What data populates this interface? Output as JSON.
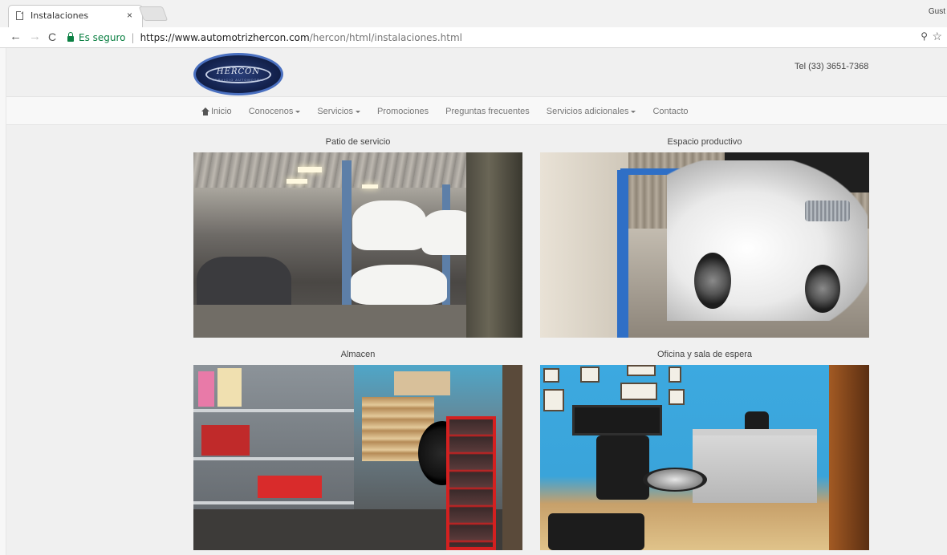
{
  "browser": {
    "tab_title": "Instalaciones",
    "tab_close": "×",
    "profile_label": "Gust",
    "secure_label": "Es seguro",
    "url_host": "https://www.automotrizhercon.com",
    "url_path": "/hercon/html/instalaciones.html",
    "icons": [
      "back-arrow-icon",
      "forward-arrow-icon",
      "reload-icon",
      "lock-icon",
      "zoom-icon",
      "star-icon"
    ]
  },
  "header": {
    "logo_text": "HERCON",
    "logo_subtext": "SERVICIO AUTOMOTRIZ",
    "phone": "Tel (33) 3651-7368"
  },
  "nav": {
    "items": [
      {
        "label": "Inicio",
        "icon": "home-icon",
        "dropdown": false
      },
      {
        "label": "Conocenos",
        "dropdown": true
      },
      {
        "label": "Servicios",
        "dropdown": true
      },
      {
        "label": "Promociones",
        "dropdown": false
      },
      {
        "label": "Preguntas frecuentes",
        "dropdown": false
      },
      {
        "label": "Servicios adicionales",
        "dropdown": true
      },
      {
        "label": "Contacto",
        "dropdown": false
      }
    ]
  },
  "gallery": {
    "sections": [
      {
        "title": "Patio de servicio"
      },
      {
        "title": "Espacio productivo"
      },
      {
        "title": "Almacen"
      },
      {
        "title": "Oficina y sala de espera"
      }
    ]
  },
  "colors": {
    "secure_green": "#0b8043",
    "nav_text": "#777777",
    "page_bg": "#f0f0f0"
  }
}
